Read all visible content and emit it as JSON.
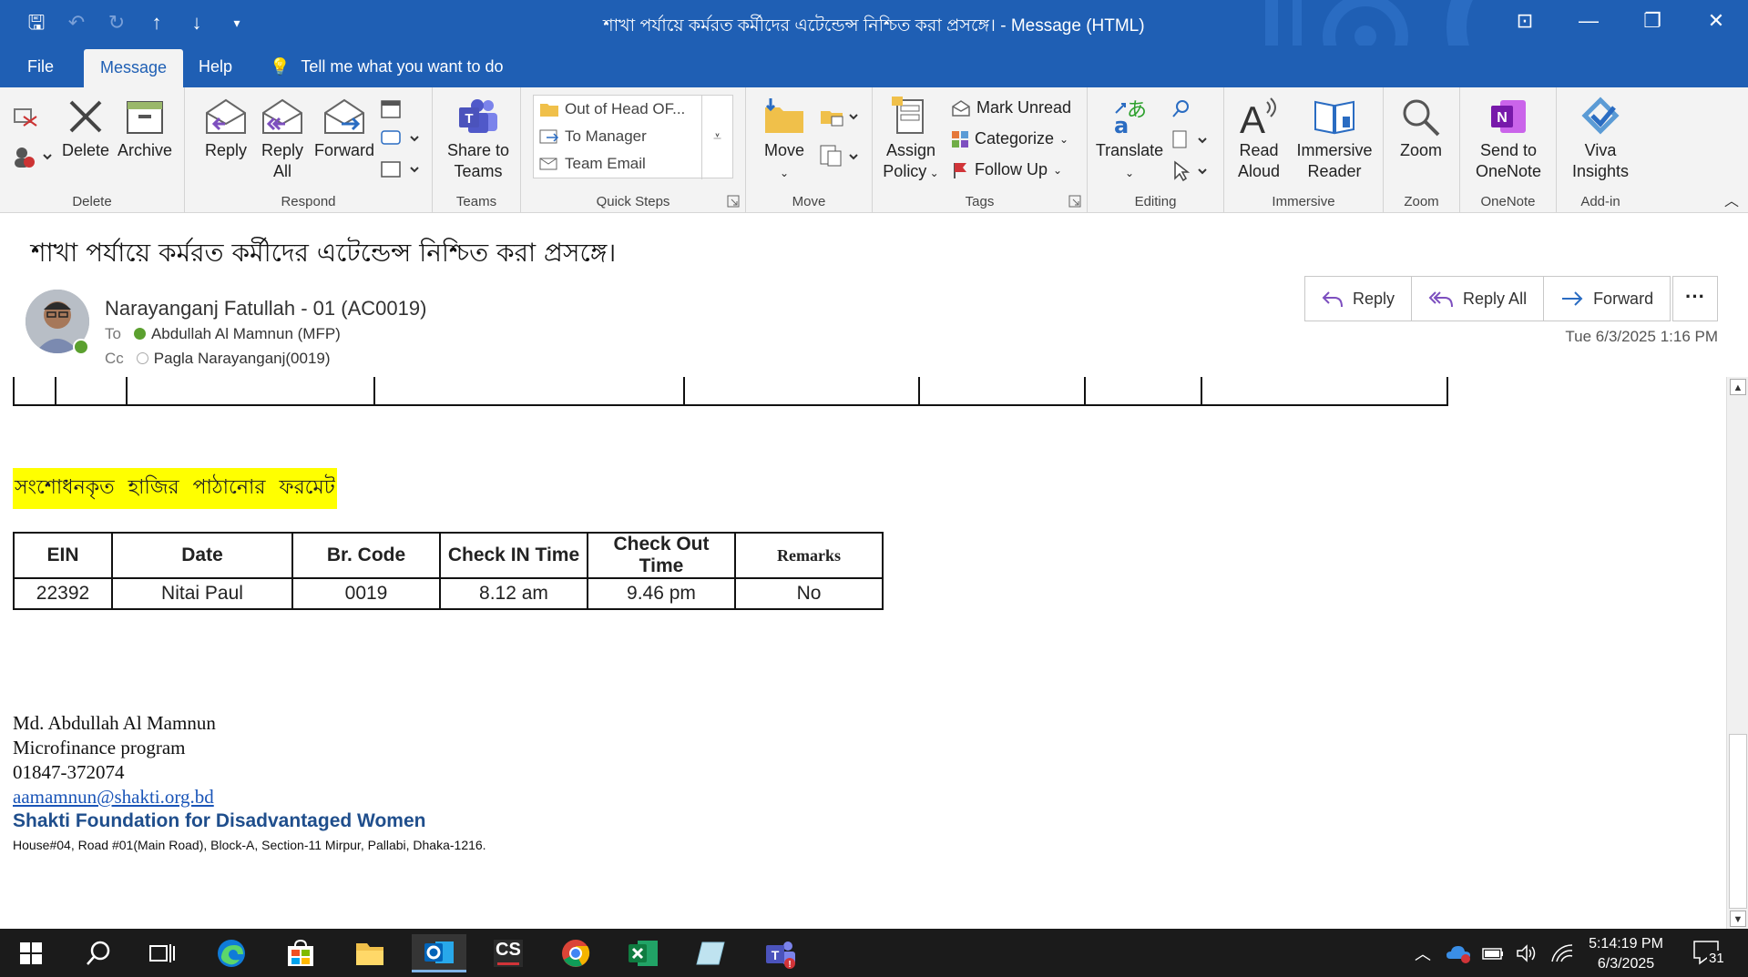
{
  "window": {
    "title": "শাখা পর্যায়ে কর্মরত কর্মীদের এটেন্ডেন্স নিশ্চিত করা প্রসঙ্গে।  -  Message (HTML)"
  },
  "menu": {
    "file": "File",
    "message": "Message",
    "help": "Help",
    "tell": "Tell me what you want to do"
  },
  "ribbon": {
    "delete_group": "Delete",
    "delete": "Delete",
    "archive": "Archive",
    "respond_group": "Respond",
    "reply": "Reply",
    "reply_all_1": "Reply",
    "reply_all_2": "All",
    "forward": "Forward",
    "teams_group": "Teams",
    "share_teams_1": "Share to",
    "share_teams_2": "Teams",
    "quick_steps_group": "Quick Steps",
    "qs_items": [
      "Out of Head OF...",
      "To Manager",
      "Team Email"
    ],
    "move_group": "Move",
    "move": "Move",
    "tags_group": "Tags",
    "assign_policy_1": "Assign",
    "assign_policy_2": "Policy",
    "mark_unread": "Mark Unread",
    "categorize": "Categorize",
    "follow_up": "Follow Up",
    "editing_group": "Editing",
    "translate": "Translate",
    "immersive_group": "Immersive",
    "read_aloud_1": "Read",
    "read_aloud_2": "Aloud",
    "immersive_reader_1": "Immersive",
    "immersive_reader_2": "Reader",
    "zoom_group": "Zoom",
    "zoom": "Zoom",
    "onenote_group": "OneNote",
    "send_onenote_1": "Send to",
    "send_onenote_2": "OneNote",
    "addin_group": "Add-in",
    "viva_1": "Viva",
    "viva_2": "Insights"
  },
  "message": {
    "subject": "শাখা পর্যায়ে কর্মরত কর্মীদের এটেন্ডেন্স নিশ্চিত করা প্রসঙ্গে।",
    "sender": "Narayanganj Fatullah - 01 (AC0019)",
    "to_label": "To",
    "to": "Abdullah Al Mamnun (MFP)",
    "cc_label": "Cc",
    "cc": "Pagla Narayanganj(0019)",
    "date": "Tue 6/3/2025 1:16 PM",
    "reply": "Reply",
    "reply_all": "Reply All",
    "forward": "Forward",
    "more": "···"
  },
  "body": {
    "highlight": "সংশোধনকৃত হাজির পাঠানোর ফরমেট",
    "table": {
      "headers": [
        "EIN",
        "Date",
        "Br. Code",
        "Check IN Time",
        "Check Out Time",
        "Remarks"
      ],
      "row": [
        "22392",
        "Nitai Paul",
        "0019",
        "8.12 am",
        "9.46 pm",
        "No"
      ]
    },
    "sig_name": "Md. Abdullah Al Mamnun",
    "sig_program": "Microfinance program",
    "sig_phone": "01847-372074",
    "sig_email": "aamamnun@shakti.org.bd",
    "sig_org": "Shakti Foundation for Disadvantaged Women",
    "sig_address": "House#04, Road #01(Main Road), Block-A, Section-11 Mirpur, Pallabi, Dhaka-1216."
  },
  "taskbar": {
    "time": "5:14:19 PM",
    "date": "6/3/2025",
    "notifications": "31",
    "cs_label": "CS"
  },
  "colors": {
    "titlebar": "#1f5fb4",
    "highlight": "#ffff00",
    "org": "#1f4e8c"
  }
}
